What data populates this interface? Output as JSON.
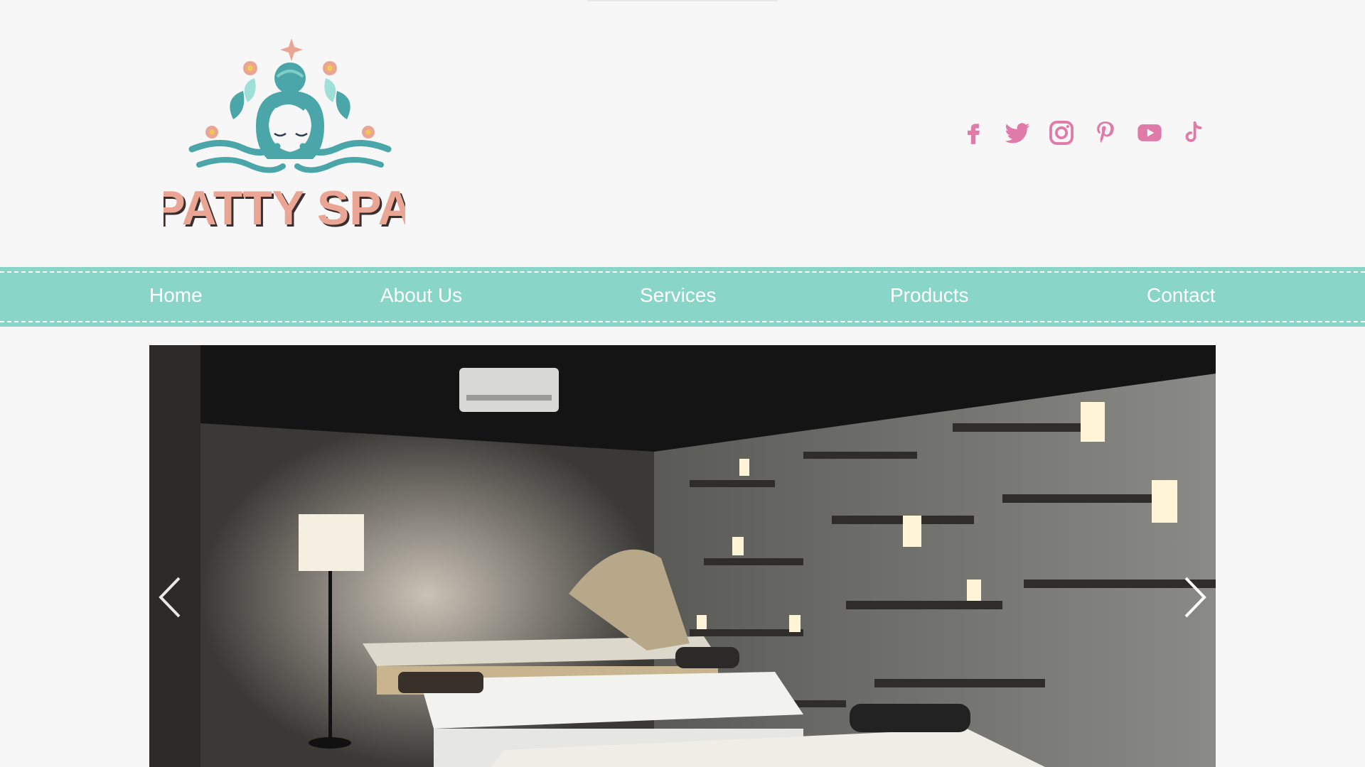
{
  "brand": {
    "name": "PATTY SPA",
    "color": "#eba595",
    "teal": "#4aa6a8"
  },
  "social": {
    "color": "#e07aa8",
    "icons": [
      "facebook-icon",
      "twitter-icon",
      "instagram-icon",
      "pinterest-icon",
      "youtube-icon",
      "tiktok-icon"
    ]
  },
  "nav": {
    "background": "#89d5c8",
    "items": [
      {
        "label": "Home"
      },
      {
        "label": "About Us"
      },
      {
        "label": "Services"
      },
      {
        "label": "Products"
      },
      {
        "label": "Contact"
      }
    ]
  },
  "slideshow": {
    "prev_icon": "chevron-left-icon",
    "next_icon": "chevron-right-icon"
  }
}
